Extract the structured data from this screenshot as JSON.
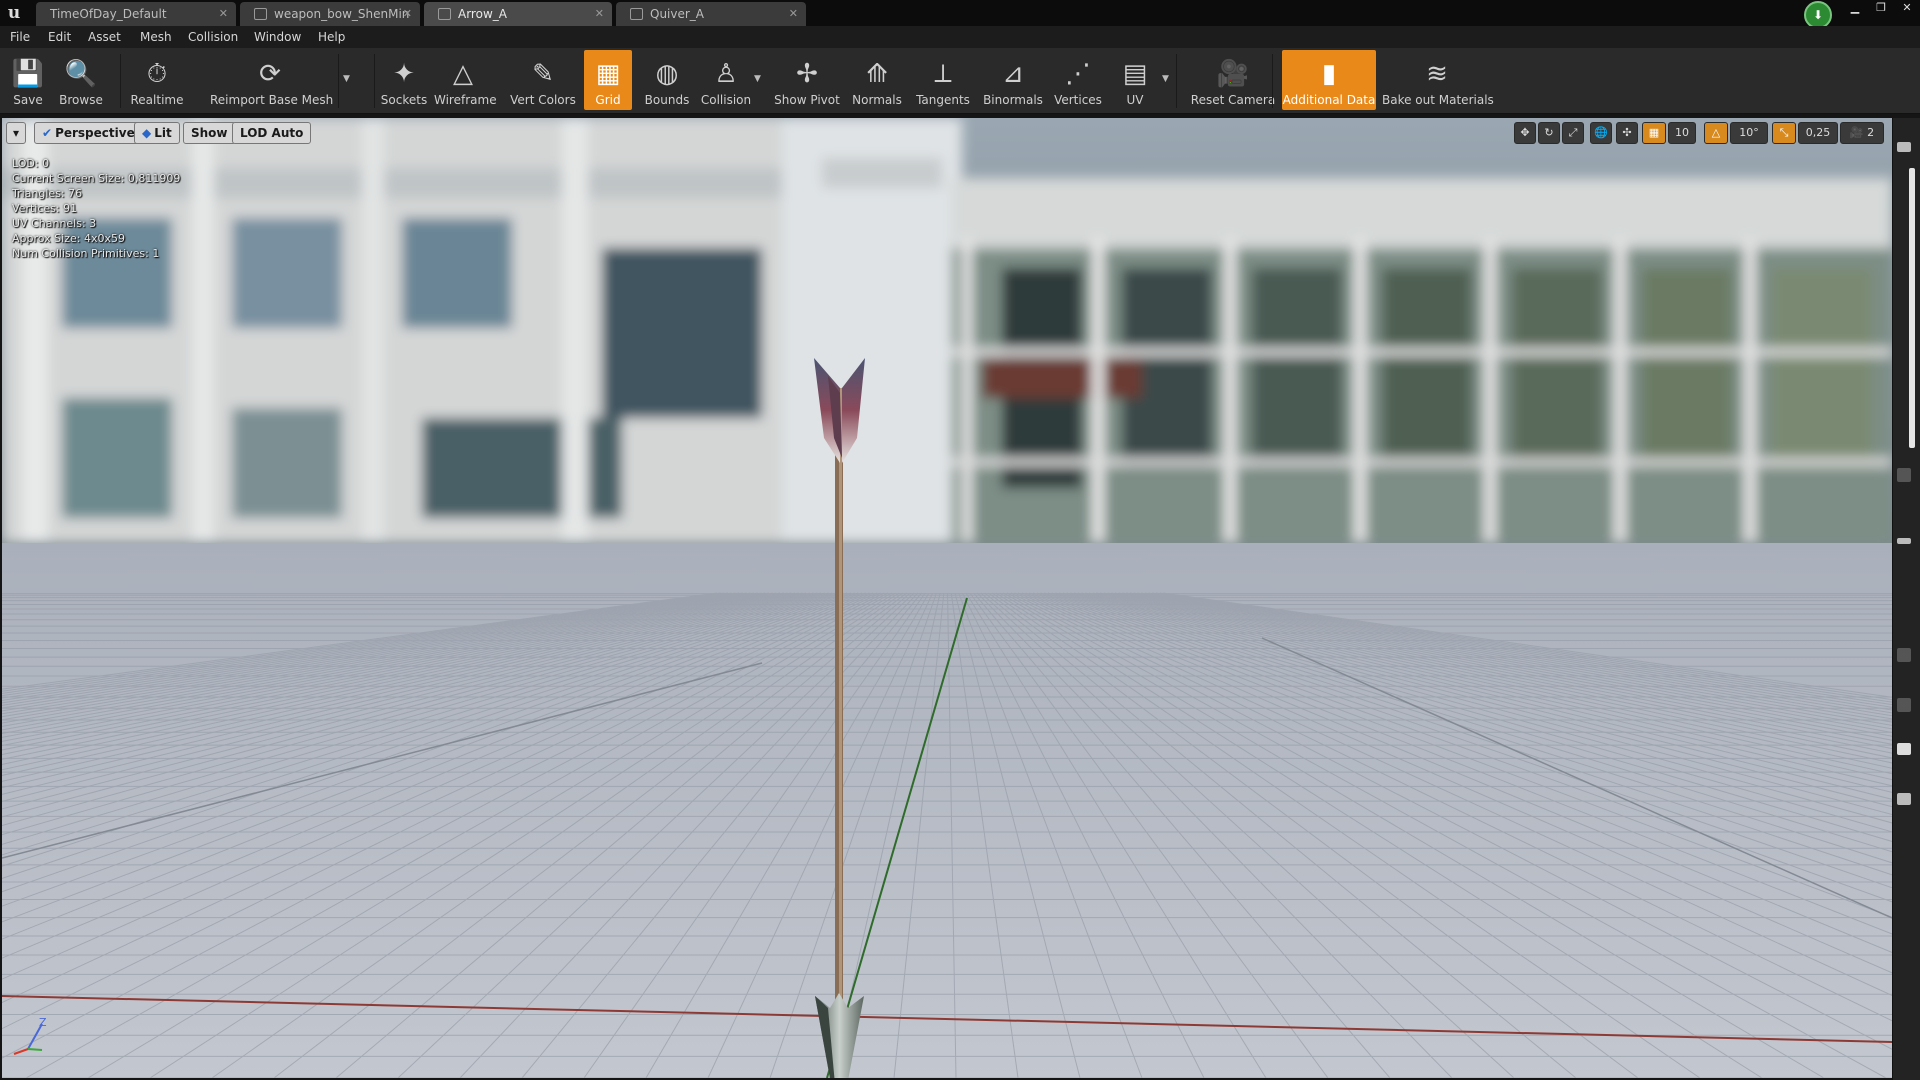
{
  "app": {
    "logo": "u"
  },
  "tabs": [
    {
      "label": "TimeOfDay_Default",
      "icon": "level-icon",
      "active": false
    },
    {
      "label": "weapon_bow_ShenMin",
      "icon": "static-mesh-icon",
      "active": false
    },
    {
      "label": "Arrow_A",
      "icon": "static-mesh-icon",
      "active": true
    },
    {
      "label": "Quiver_A",
      "icon": "static-mesh-icon",
      "active": false
    }
  ],
  "tab_close": "✕",
  "window_controls": {
    "minimize": "▁",
    "maximize": "❐",
    "close": "✕"
  },
  "source_control": {
    "icon": "source-control-icon",
    "glyph": "⬇"
  },
  "menu": [
    "File",
    "Edit",
    "Asset",
    "Mesh",
    "Collision",
    "Window",
    "Help"
  ],
  "toolbar": [
    {
      "label": "Save",
      "icon": "save-icon",
      "glyph": "💾",
      "active": false
    },
    {
      "label": "Browse",
      "icon": "browse-icon",
      "glyph": "🔍",
      "active": false
    },
    {
      "label": "Realtime",
      "icon": "realtime-icon",
      "glyph": "⏱",
      "active": false
    },
    {
      "label": "Reimport Base Mesh",
      "icon": "reimport-icon",
      "glyph": "⟳",
      "active": false
    },
    {
      "label": "Sockets",
      "icon": "sockets-icon",
      "glyph": "✦",
      "active": false
    },
    {
      "label": "Wireframe",
      "icon": "wireframe-icon",
      "glyph": "△",
      "active": false
    },
    {
      "label": "Vert Colors",
      "icon": "vert-colors-icon",
      "glyph": "✎",
      "active": false
    },
    {
      "label": "Grid",
      "icon": "grid-icon",
      "glyph": "▦",
      "active": true
    },
    {
      "label": "Bounds",
      "icon": "bounds-icon",
      "glyph": "◍",
      "active": false
    },
    {
      "label": "Collision",
      "icon": "collision-icon",
      "glyph": "♙",
      "active": false
    },
    {
      "label": "Show Pivot",
      "icon": "pivot-icon",
      "glyph": "✢",
      "active": false
    },
    {
      "label": "Normals",
      "icon": "normals-icon",
      "glyph": "⟰",
      "active": false
    },
    {
      "label": "Tangents",
      "icon": "tangents-icon",
      "glyph": "⟂",
      "active": false
    },
    {
      "label": "Binormals",
      "icon": "binormals-icon",
      "glyph": "⊿",
      "active": false
    },
    {
      "label": "Vertices",
      "icon": "vertices-icon",
      "glyph": "⋰",
      "active": false
    },
    {
      "label": "UV",
      "icon": "uv-icon",
      "glyph": "▤",
      "active": false
    },
    {
      "label": "Reset Camera",
      "icon": "camera-icon",
      "glyph": "🎥",
      "active": false
    },
    {
      "label": "Additional Data",
      "icon": "additional-data-icon",
      "glyph": "▮",
      "active": true
    },
    {
      "label": "Bake out Materials",
      "icon": "bake-materials-icon",
      "glyph": "≋",
      "active": false
    }
  ],
  "viewport": {
    "menu_glyph": "▾",
    "view_mode": "Perspective",
    "lighting": "Lit",
    "show": "Show",
    "lod": "LOD Auto",
    "check_glyph": "✔",
    "right_controls": [
      {
        "name": "translate-tool",
        "text": "✥"
      },
      {
        "name": "rotate-tool",
        "text": "↻"
      },
      {
        "name": "scale-tool",
        "text": "⤢"
      },
      {
        "name": "world-local-toggle",
        "text": "🌐"
      },
      {
        "name": "surface-snap",
        "text": "✣"
      },
      {
        "name": "grid-snap-toggle",
        "text": "▦"
      },
      {
        "name": "grid-snap-value",
        "text": "10"
      },
      {
        "name": "rotation-snap-toggle",
        "text": "△"
      },
      {
        "name": "rotation-snap-value",
        "text": "10°"
      },
      {
        "name": "scale-snap-toggle",
        "text": "⤡"
      },
      {
        "name": "scale-snap-value",
        "text": "0,25"
      },
      {
        "name": "camera-speed",
        "text": "🎥 2"
      }
    ],
    "stats": [
      "LOD:  0",
      "Current Screen Size:  0,811909",
      "Triangles:  76",
      "Vertices:  91",
      "UV Channels:  3",
      "Approx Size: 4x0x59",
      "Num Collision Primitives:  1"
    ],
    "axis": {
      "z": "Z"
    }
  },
  "colors": {
    "accent": "#e8891a",
    "sky": "#c9d2d8",
    "floor": "#b9bec7",
    "grid_line": "#9aa0ab",
    "x_axis": "#8e3a34",
    "y_axis": "#2f6b2a"
  }
}
